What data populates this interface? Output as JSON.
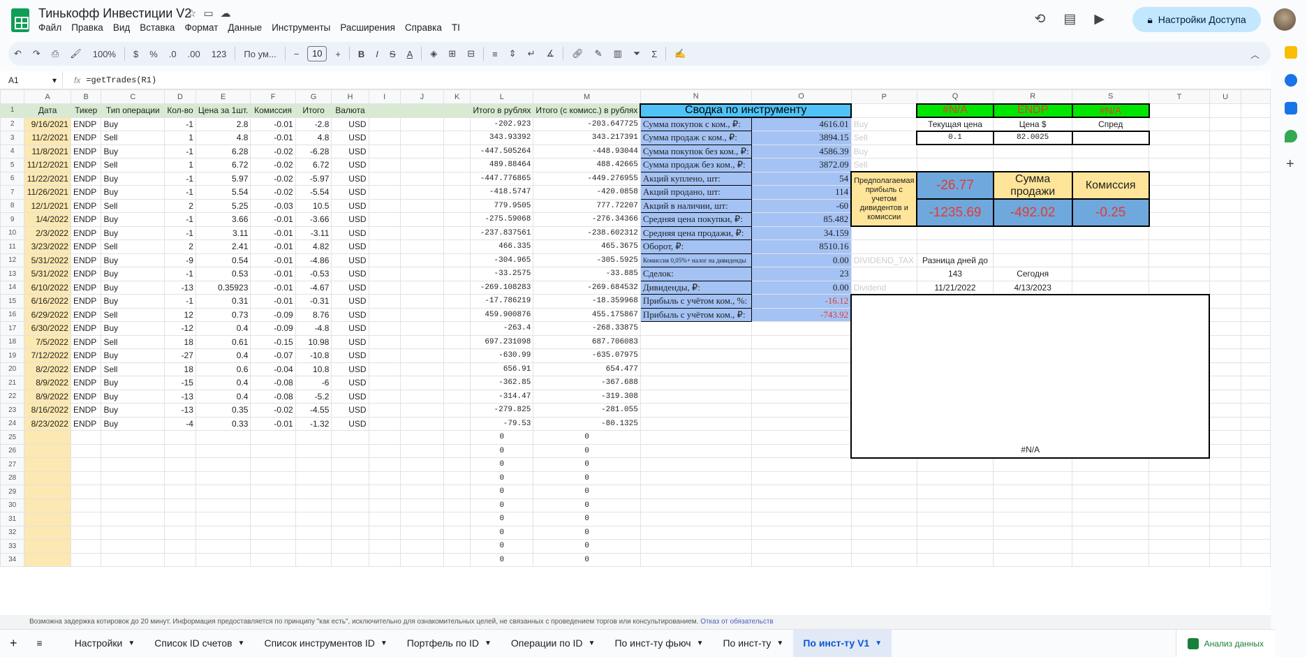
{
  "app": {
    "title": "Тинькофф Инвестиции V2",
    "share_label": "Настройки Доступа"
  },
  "menu": [
    "Файл",
    "Правка",
    "Вид",
    "Вставка",
    "Формат",
    "Данные",
    "Инструменты",
    "Расширения",
    "Справка",
    "TI"
  ],
  "toolbar": {
    "zoom": "100%",
    "currency": "$",
    "percent": "%",
    "dec_less": ".0",
    "dec_more": ".00",
    "format_more": "123",
    "font": "По ум...",
    "font_size": "10"
  },
  "formula_bar": {
    "cell": "A1",
    "fx": "fx",
    "formula": "=getTrades(R1)"
  },
  "columns": [
    "A",
    "B",
    "C",
    "D",
    "E",
    "F",
    "G",
    "H",
    "I",
    "J",
    "K",
    "L",
    "M",
    "N",
    "O",
    "P",
    "Q",
    "R",
    "S",
    "T",
    "U"
  ],
  "headers": {
    "A": "Дата",
    "B": "Тикер",
    "C": "Тип операции",
    "D": "Кол-во",
    "E": "Цена за 1шт.",
    "F": "Комиссия",
    "G": "Итого",
    "H": "Валюта",
    "L": "Итого в рублях",
    "M": "Итого (с комисс.) в рублях"
  },
  "trades": [
    [
      "9/16/2021",
      "ENDP",
      "Buy",
      "-1",
      "2.8",
      "-0.01",
      "-2.8",
      "USD",
      "-202.923",
      "-203.647725"
    ],
    [
      "11/2/2021",
      "ENDP",
      "Sell",
      "1",
      "4.8",
      "-0.01",
      "4.8",
      "USD",
      "343.93392",
      "343.217391"
    ],
    [
      "11/8/2021",
      "ENDP",
      "Buy",
      "-1",
      "6.28",
      "-0.02",
      "-6.28",
      "USD",
      "-447.505264",
      "-448.93044"
    ],
    [
      "11/12/2021",
      "ENDP",
      "Sell",
      "1",
      "6.72",
      "-0.02",
      "6.72",
      "USD",
      "489.88464",
      "488.42665"
    ],
    [
      "11/22/2021",
      "ENDP",
      "Buy",
      "-1",
      "5.97",
      "-0.02",
      "-5.97",
      "USD",
      "-447.776865",
      "-449.276955"
    ],
    [
      "11/26/2021",
      "ENDP",
      "Buy",
      "-1",
      "5.54",
      "-0.02",
      "-5.54",
      "USD",
      "-418.5747",
      "-420.0858"
    ],
    [
      "12/1/2021",
      "ENDP",
      "Sell",
      "2",
      "5.25",
      "-0.03",
      "10.5",
      "USD",
      "779.9505",
      "777.72207"
    ],
    [
      "1/4/2022",
      "ENDP",
      "Buy",
      "-1",
      "3.66",
      "-0.01",
      "-3.66",
      "USD",
      "-275.59068",
      "-276.34366"
    ],
    [
      "2/3/2022",
      "ENDP",
      "Buy",
      "-1",
      "3.11",
      "-0.01",
      "-3.11",
      "USD",
      "-237.837561",
      "-238.602312"
    ],
    [
      "3/23/2022",
      "ENDP",
      "Sell",
      "2",
      "2.41",
      "-0.01",
      "4.82",
      "USD",
      "466.335",
      "465.3675"
    ],
    [
      "5/31/2022",
      "ENDP",
      "Buy",
      "-9",
      "0.54",
      "-0.01",
      "-4.86",
      "USD",
      "-304.965",
      "-305.5925"
    ],
    [
      "5/31/2022",
      "ENDP",
      "Buy",
      "-1",
      "0.53",
      "-0.01",
      "-0.53",
      "USD",
      "-33.2575",
      "-33.885"
    ],
    [
      "6/10/2022",
      "ENDP",
      "Buy",
      "-13",
      "0.35923",
      "-0.01",
      "-4.67",
      "USD",
      "-269.108283",
      "-269.684532"
    ],
    [
      "6/16/2022",
      "ENDP",
      "Buy",
      "-1",
      "0.31",
      "-0.01",
      "-0.31",
      "USD",
      "-17.786219",
      "-18.359968"
    ],
    [
      "6/29/2022",
      "ENDP",
      "Sell",
      "12",
      "0.73",
      "-0.09",
      "8.76",
      "USD",
      "459.900876",
      "455.175867"
    ],
    [
      "6/30/2022",
      "ENDP",
      "Buy",
      "-12",
      "0.4",
      "-0.09",
      "-4.8",
      "USD",
      "-263.4",
      "-268.33875"
    ],
    [
      "7/5/2022",
      "ENDP",
      "Sell",
      "18",
      "0.61",
      "-0.15",
      "10.98",
      "USD",
      "697.231098",
      "687.706083"
    ],
    [
      "7/12/2022",
      "ENDP",
      "Buy",
      "-27",
      "0.4",
      "-0.07",
      "-10.8",
      "USD",
      "-630.99",
      "-635.07975"
    ],
    [
      "8/2/2022",
      "ENDP",
      "Sell",
      "18",
      "0.6",
      "-0.04",
      "10.8",
      "USD",
      "656.91",
      "654.477"
    ],
    [
      "8/9/2022",
      "ENDP",
      "Buy",
      "-15",
      "0.4",
      "-0.08",
      "-6",
      "USD",
      "-362.85",
      "-367.688"
    ],
    [
      "8/9/2022",
      "ENDP",
      "Buy",
      "-13",
      "0.4",
      "-0.08",
      "-5.2",
      "USD",
      "-314.47",
      "-319.308"
    ],
    [
      "8/16/2022",
      "ENDP",
      "Buy",
      "-13",
      "0.35",
      "-0.02",
      "-4.55",
      "USD",
      "-279.825",
      "-281.055"
    ],
    [
      "8/23/2022",
      "ENDP",
      "Buy",
      "-4",
      "0.33",
      "-0.01",
      "-1.32",
      "USD",
      "-79.53",
      "-80.1325"
    ]
  ],
  "zero": "0",
  "summary": {
    "title": "Сводка по инструменту",
    "rows": [
      [
        "Сумма покупок с ком., ₽:",
        "4616.01"
      ],
      [
        "Сумма продаж с ком., ₽:",
        "3894.15"
      ],
      [
        "Сумма покупок без ком., ₽:",
        "4586.39"
      ],
      [
        "Сумма продаж без ком., ₽:",
        "3872.09"
      ],
      [
        "Акций куплено, шт:",
        "54"
      ],
      [
        "Акций продано, шт:",
        "114"
      ],
      [
        "Акций в наличии, шт:",
        "-60"
      ],
      [
        "Средняя цена покупки, ₽:",
        "85.482"
      ],
      [
        "Средняя цена продажи, ₽:",
        "34.159"
      ],
      [
        "Оборот, ₽:",
        "8510.16"
      ],
      [
        "Комиссия 0,05%+ налог на дивиденды",
        "0.00"
      ],
      [
        "Сделок:",
        "23"
      ],
      [
        "Дивиденды, ₽:",
        "0.00"
      ],
      [
        "Прибыль с учётом ком., %:",
        "-16.12"
      ],
      [
        "Прибыль с учётом ком., ₽:",
        "-743.92"
      ]
    ]
  },
  "p_labels": {
    "buy1": "Buy",
    "sell1": "Sell",
    "buy2": "Buy",
    "sell2": "Sell",
    "div_tax": "DIVIDEND_TAX",
    "dividend": "Dividend"
  },
  "quote": {
    "q1": "#N/A",
    "r1": "ENDP",
    "s1": "#N/A",
    "price_label": "Текущая цена",
    "price_usd_label": "Цена  $",
    "spread_label": "Спред",
    "price": "0.1",
    "price_usd": "82.0025",
    "spread": ""
  },
  "profit": {
    "label": "Предполагаемая прибыль с учетом дивидентов и комиссии",
    "v1": "-26.77",
    "sale_label": "Сумма продажи",
    "commission_label": "Комиссия",
    "v2": "-1235.69",
    "sale": "-492.02",
    "commission": "-0.25"
  },
  "days": {
    "label": "Разница дней до",
    "value": "143",
    "date": "11/21/2022",
    "today_label": "Сегодня",
    "today": "4/13/2023"
  },
  "chart_na": "#N/A",
  "footnote": {
    "text": "Возможна задержка котировок до 20 минут. Информация предоставляется по принципу \"как есть\", исключительно для ознакомительных целей, не связанных с проведением торгов или консультированием.",
    "link": "Отказ от обязательств"
  },
  "sheets": [
    "Настройки",
    "Список ID счетов",
    "Список инструментов ID",
    "Портфель по ID",
    "Операции по ID",
    "По инст-ту фьюч",
    "По инст-ту",
    "По инст-ту V1"
  ],
  "active_sheet": "По инст-ту V1",
  "explore_label": "Анализ данных"
}
